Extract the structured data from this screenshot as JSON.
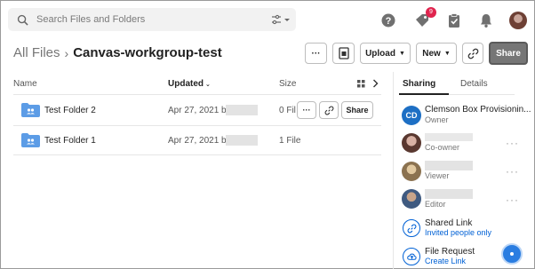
{
  "search": {
    "placeholder": "Search Files and Folders"
  },
  "header": {
    "notification_count": "9"
  },
  "breadcrumb": {
    "root": "All Files",
    "separator": "›",
    "current": "Canvas-workgroup-test"
  },
  "toolbar": {
    "more_label": "···",
    "upload_label": "Upload",
    "new_label": "New",
    "share_label": "Share"
  },
  "list": {
    "columns": {
      "name": "Name",
      "updated": "Updated",
      "size": "Size"
    },
    "rows": [
      {
        "name": "Test Folder 2",
        "updated": "Apr 27, 2021 by",
        "size": "0 Fil",
        "share_label": "Share",
        "more_label": "···"
      },
      {
        "name": "Test Folder 1",
        "updated": "Apr 27, 2021 by",
        "size": "1 File"
      }
    ]
  },
  "sidebar": {
    "tabs": {
      "sharing": "Sharing",
      "details": "Details"
    },
    "collaborators": [
      {
        "initials": "CD",
        "name": "Clemson Box Provisionin...",
        "role": "Owner",
        "more": ""
      },
      {
        "initials": "",
        "name": "",
        "role": "Co-owner",
        "more": "···"
      },
      {
        "initials": "",
        "name": "",
        "role": "Viewer",
        "more": "···"
      },
      {
        "initials": "",
        "name": "",
        "role": "Editor",
        "more": "···"
      }
    ],
    "shared_link": {
      "title": "Shared Link",
      "subtitle": "Invited people only"
    },
    "file_request": {
      "title": "File Request",
      "subtitle": "Create Link"
    }
  },
  "colors": {
    "accent": "#0061d5",
    "badge": "#e0244e",
    "folder": "#5c9ce6",
    "owner_avatar": "#1d6fc4"
  }
}
